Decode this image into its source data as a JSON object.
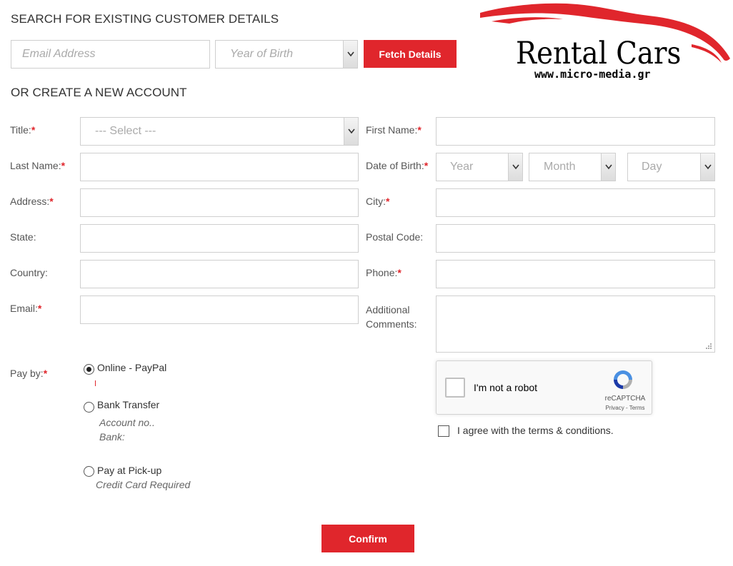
{
  "search": {
    "heading": "SEARCH FOR EXISTING CUSTOMER DETAILS",
    "email_placeholder": "Email Address",
    "yob_placeholder": "Year of Birth",
    "fetch_label": "Fetch Details"
  },
  "logo": {
    "title": "Rental Cars",
    "url": "www.micro-media.gr",
    "color": "#e0262c"
  },
  "create": {
    "heading": "OR CREATE A NEW ACCOUNT"
  },
  "form": {
    "title_label": "Title:",
    "title_placeholder": "--- Select ---",
    "first_name_label": "First Name:",
    "last_name_label": "Last Name:",
    "dob_label": "Date of Birth:",
    "dob_year": "Year",
    "dob_month": "Month",
    "dob_day": "Day",
    "address_label": "Address:",
    "city_label": "City:",
    "state_label": "State:",
    "postal_label": "Postal Code:",
    "country_label": "Country:",
    "phone_label": "Phone:",
    "email_label": "Email:",
    "comments_label_1": "Additional",
    "comments_label_2": "Comments:",
    "required_mark": "*"
  },
  "payment": {
    "label": "Pay by:",
    "options": [
      {
        "label": "Online - PayPal",
        "selected": true,
        "note": ""
      },
      {
        "label": "Bank Transfer",
        "selected": false,
        "note_1": "Account no..",
        "note_2": "Bank:"
      },
      {
        "label": "Pay at Pick-up",
        "selected": false,
        "note": "Credit Card Required"
      }
    ]
  },
  "captcha": {
    "label": "I'm not a robot",
    "brand": "reCAPTCHA",
    "links": "Privacy - Terms"
  },
  "terms": {
    "label": "I agree with the terms & conditions."
  },
  "confirm": {
    "label": "Confirm"
  }
}
